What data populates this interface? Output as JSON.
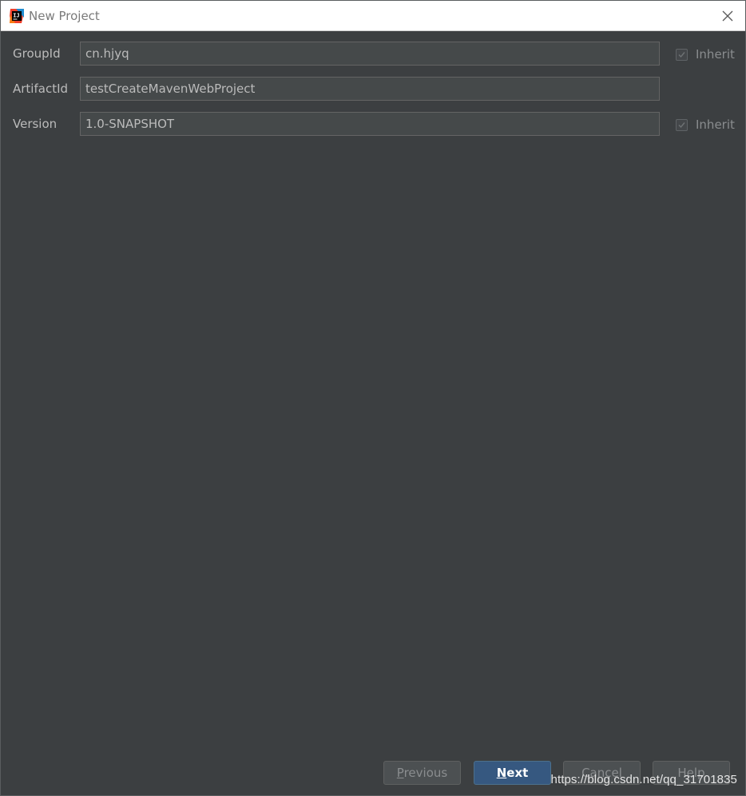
{
  "window": {
    "title": "New Project",
    "icon": "intellij-idea-icon",
    "close_icon": "close-icon"
  },
  "form": {
    "rows": [
      {
        "label": "GroupId",
        "value": "cn.hjyq",
        "inherit_label": "Inherit",
        "inherit_checked": true
      },
      {
        "label": "ArtifactId",
        "value": "testCreateMavenWebProject"
      },
      {
        "label": "Version",
        "value": "1.0-SNAPSHOT",
        "inherit_label": "Inherit",
        "inherit_checked": true
      }
    ]
  },
  "buttons": {
    "previous": {
      "label_mnemonic": "P",
      "label_rest": "revious"
    },
    "next": {
      "label_mnemonic": "N",
      "label_rest": "ext"
    },
    "cancel": {
      "label": "Cancel"
    },
    "help": {
      "label": "Help"
    }
  },
  "watermark": "https://blog.csdn.net/qq_31701835",
  "colors": {
    "background": "#3c3f41",
    "input_background": "#45494a",
    "default_button": "#365880",
    "text": "#bbbbbb"
  }
}
